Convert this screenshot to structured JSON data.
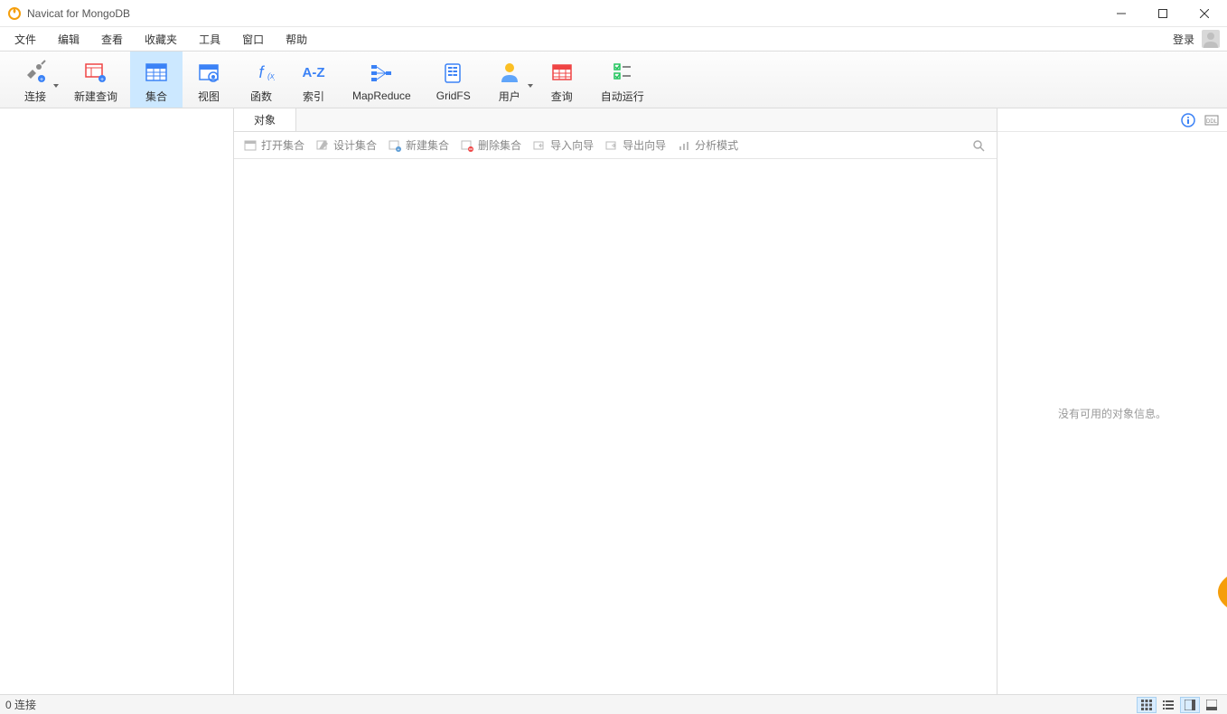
{
  "window": {
    "title": "Navicat for MongoDB"
  },
  "menu": {
    "items": [
      "文件",
      "编辑",
      "查看",
      "收藏夹",
      "工具",
      "窗口",
      "帮助"
    ],
    "login": "登录"
  },
  "toolbar": {
    "items": [
      {
        "key": "connection",
        "label": "连接",
        "dropdown": true
      },
      {
        "key": "new-query",
        "label": "新建查询",
        "dropdown": false
      },
      {
        "key": "collection",
        "label": "集合",
        "dropdown": false,
        "active": true
      },
      {
        "key": "view",
        "label": "视图",
        "dropdown": false
      },
      {
        "key": "function",
        "label": "函数",
        "dropdown": false
      },
      {
        "key": "index",
        "label": "索引",
        "dropdown": false
      },
      {
        "key": "mapreduce",
        "label": "MapReduce",
        "dropdown": false
      },
      {
        "key": "gridfs",
        "label": "GridFS",
        "dropdown": false
      },
      {
        "key": "user",
        "label": "用户",
        "dropdown": true
      },
      {
        "key": "query",
        "label": "查询",
        "dropdown": false
      },
      {
        "key": "automation",
        "label": "自动运行",
        "dropdown": false
      }
    ]
  },
  "tabs": {
    "items": [
      "对象"
    ]
  },
  "subtoolbar": {
    "items": [
      {
        "key": "open-collection",
        "label": "打开集合"
      },
      {
        "key": "design-collection",
        "label": "设计集合"
      },
      {
        "key": "new-collection",
        "label": "新建集合"
      },
      {
        "key": "delete-collection",
        "label": "删除集合"
      },
      {
        "key": "import-wizard",
        "label": "导入向导"
      },
      {
        "key": "export-wizard",
        "label": "导出向导"
      },
      {
        "key": "analyze-schema",
        "label": "分析模式"
      }
    ]
  },
  "rightpane": {
    "message": "没有可用的对象信息。"
  },
  "statusbar": {
    "text": "0 连接"
  }
}
